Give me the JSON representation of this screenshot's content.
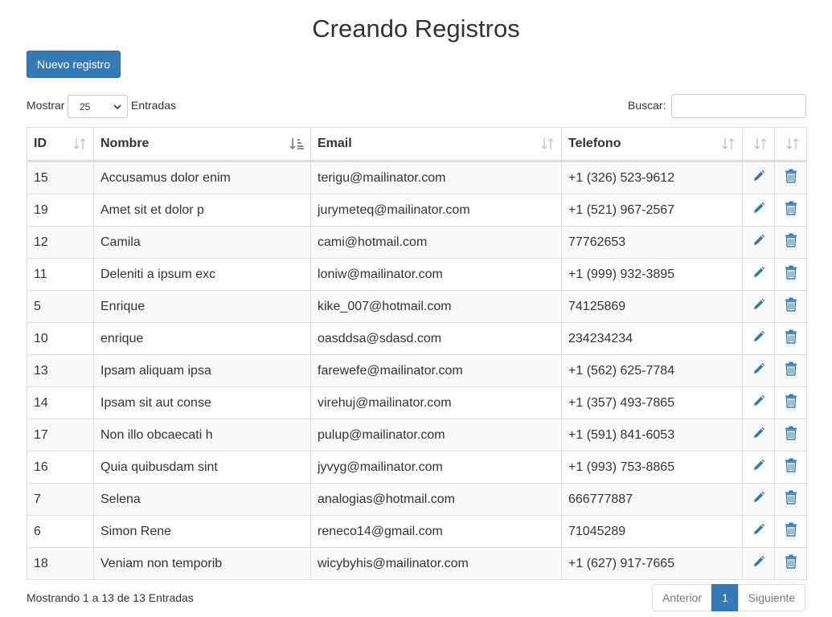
{
  "page": {
    "title": "Creando Registros"
  },
  "toolbar": {
    "new_label": "Nuevo registro"
  },
  "length": {
    "prefix": "Mostrar",
    "value": "25",
    "suffix": "Entradas"
  },
  "search": {
    "label": "Buscar:",
    "value": ""
  },
  "table": {
    "columns": [
      "ID",
      "Nombre",
      "Email",
      "Telefono",
      "",
      ""
    ],
    "sorted_column": "Nombre",
    "rows": [
      [
        "15",
        "Accusamus dolor enim",
        "terigu@mailinator.com",
        "+1 (326) 523-9612"
      ],
      [
        "19",
        "Amet sit et dolor p",
        "jurymeteq@mailinator.com",
        "+1 (521) 967-2567"
      ],
      [
        "12",
        "Camila",
        "cami@hotmail.com",
        "77762653"
      ],
      [
        "11",
        "Deleniti a ipsum exc",
        "loniw@mailinator.com",
        "+1 (999) 932-3895"
      ],
      [
        "5",
        "Enrique",
        "kike_007@hotmail.com",
        "74125869"
      ],
      [
        "10",
        "enrique",
        "oasddsa@sdasd.com",
        "234234234"
      ],
      [
        "13",
        "Ipsam aliquam ipsa",
        "farewefe@mailinator.com",
        "+1 (562) 625-7784"
      ],
      [
        "14",
        "Ipsam sit aut conse",
        "virehuj@mailinator.com",
        "+1 (357) 493-7865"
      ],
      [
        "17",
        "Non illo obcaecati h",
        "pulup@mailinator.com",
        "+1 (591) 841-6053"
      ],
      [
        "16",
        "Quia quibusdam sint",
        "jyvyg@mailinator.com",
        "+1 (993) 753-8865"
      ],
      [
        "7",
        "Selena",
        "analogias@hotmail.com",
        "666777887"
      ],
      [
        "6",
        "Simon Rene",
        "reneco14@gmail.com",
        "71045289"
      ],
      [
        "18",
        "Veniam non temporib",
        "wicybyhis@mailinator.com",
        "+1 (627) 917-7665"
      ]
    ],
    "row_actions": [
      "pencil-icon",
      "trash-icon"
    ]
  },
  "footer": {
    "info": "Mostrando 1 a 13 de 13 Entradas"
  },
  "pagination": {
    "prev": "Anterior",
    "current": "1",
    "next": "Siguiente"
  },
  "colors": {
    "primary": "#337ab7",
    "border": "#dddddd",
    "stripe": "#f9f9f9",
    "text": "#333333"
  }
}
